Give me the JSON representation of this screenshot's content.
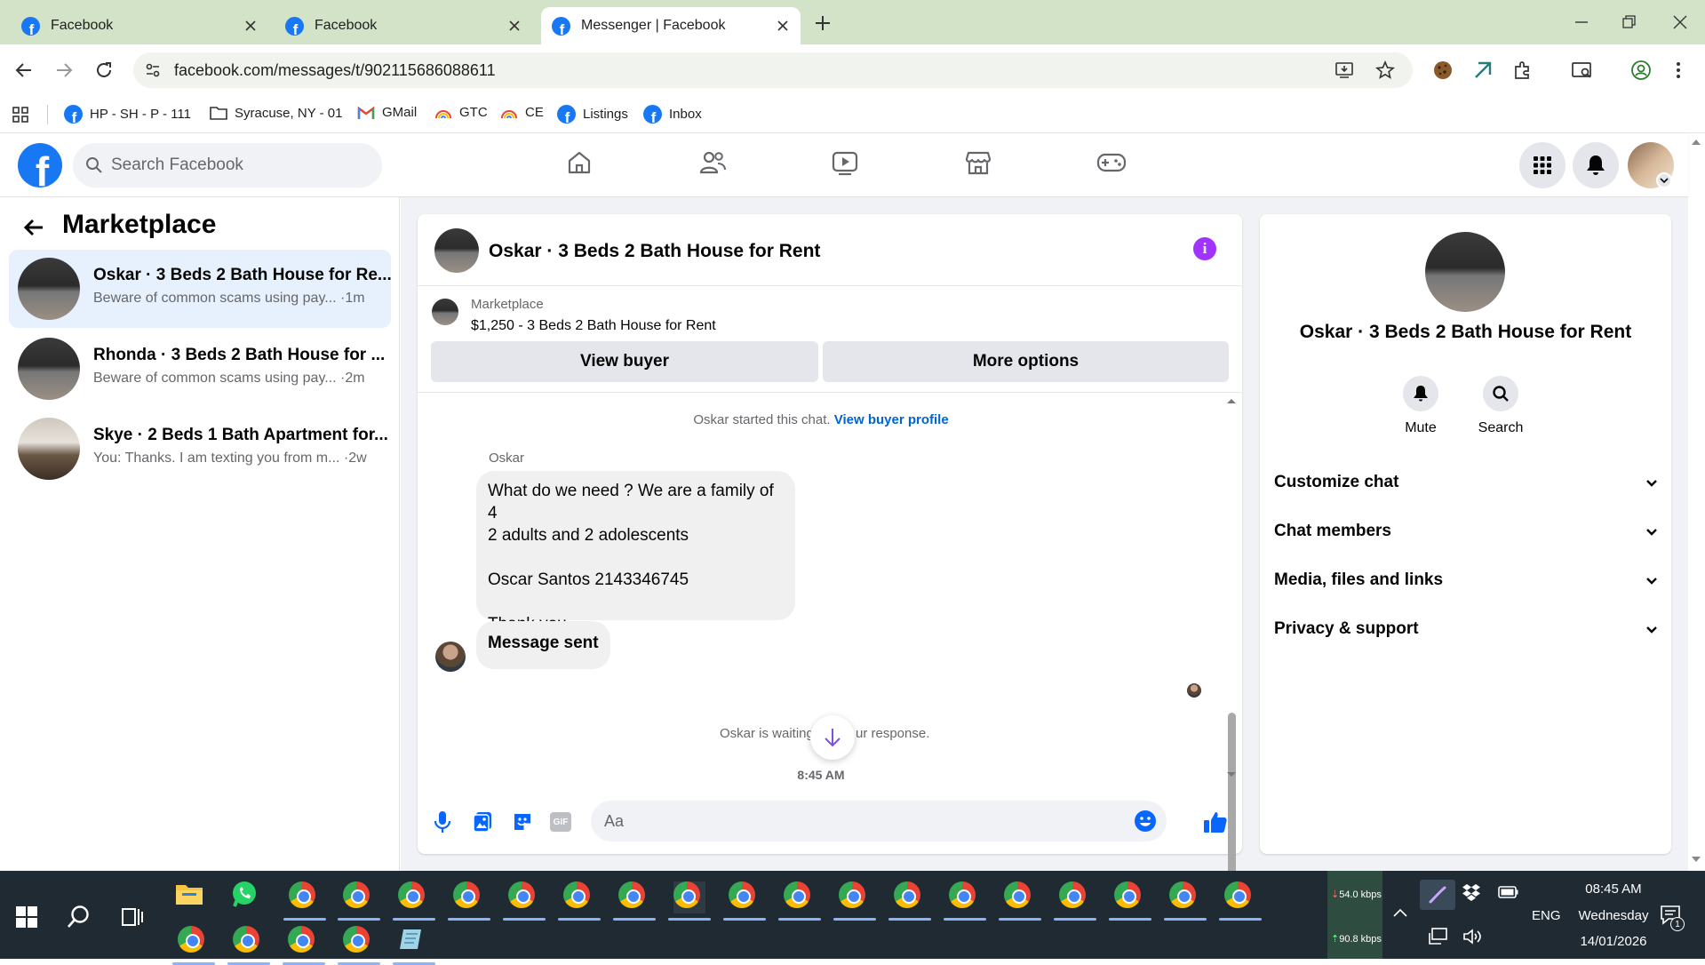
{
  "browser": {
    "tabs": [
      {
        "label": "Facebook",
        "active": false
      },
      {
        "label": "Facebook",
        "active": false
      },
      {
        "label": "Messenger | Facebook",
        "active": true
      }
    ],
    "url": "facebook.com/messages/t/902115686088611",
    "bookmarks": [
      {
        "label": "HP - SH - P - 111",
        "icon": "facebook-icon"
      },
      {
        "label": "Syracuse, NY - 01",
        "icon": "folder-icon"
      },
      {
        "label": "GMail",
        "icon": "gmail-icon"
      },
      {
        "label": "GTC",
        "icon": "rainbow-icon"
      },
      {
        "label": "CE",
        "icon": "rainbow-icon"
      },
      {
        "label": "Listings",
        "icon": "facebook-icon"
      },
      {
        "label": "Inbox",
        "icon": "facebook-icon"
      }
    ]
  },
  "facebook": {
    "search_placeholder": "Search Facebook"
  },
  "left_panel": {
    "title": "Marketplace",
    "conversations": [
      {
        "title": "Oskar · 3 Beds 2 Bath House for Re...",
        "preview": "Beware of common scams using pay...",
        "time": "·1m",
        "selected": true
      },
      {
        "title": "Rhonda · 3 Beds 2 Bath House for ...",
        "preview": "Beware of common scams using pay...",
        "time": "·2m",
        "selected": false
      },
      {
        "title": "Skye · 2 Beds 1 Bath Apartment for...",
        "preview": "You: Thanks. I am texting you from m...",
        "time": "·2w",
        "selected": false
      }
    ]
  },
  "chat": {
    "header_title": "Oskar · 3 Beds 2 Bath House for Rent",
    "listing_source": "Marketplace",
    "listing_text": "$1,250 - 3 Beds 2 Bath House for Rent",
    "view_buyer_label": "View buyer",
    "more_options_label": "More options",
    "started_text": "Oskar started this chat.",
    "view_buyer_profile_link": "View buyer profile",
    "sender_name": "Oskar",
    "message_lines": [
      "What do we need ? We are a family of 4",
      "2 adults and 2 adolescents",
      "",
      "Oscar Santos 2143346745",
      "",
      "Thank you"
    ],
    "message_sent_text": "Message sent",
    "waiting_text_left": "Oskar is waiting",
    "waiting_text_right": "ur response.",
    "timestamp": "8:45 AM",
    "composer_placeholder": "Aa"
  },
  "info_panel": {
    "title": "Oskar · 3 Beds 2 Bath House for Rent",
    "mute_label": "Mute",
    "search_label": "Search",
    "sections": [
      "Customize chat",
      "Chat members",
      "Media, files and links",
      "Privacy & support"
    ]
  },
  "taskbar": {
    "network_down": "54.0 kbps",
    "network_up": "90.8 kbps",
    "language": "ENG",
    "time": "08:45 AM",
    "day": "Wednesday",
    "date": "14/01/2026",
    "notification_count": "1"
  },
  "colors": {
    "fb_blue": "#1877f2",
    "tab_strip": "#d3e3c7",
    "selected_conv": "#e7f0fd",
    "info_purple": "#a033ff"
  }
}
